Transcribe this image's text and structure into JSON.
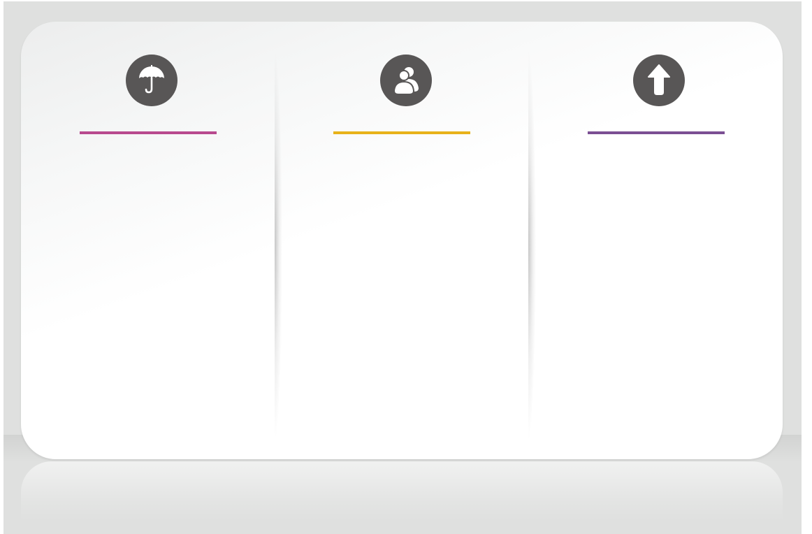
{
  "colors": {
    "card_background": "#ffffff",
    "backdrop": "#dfe0df",
    "icon_circle": "#585656",
    "icon_glyph": "#ffffff"
  },
  "panels": [
    {
      "icon": "umbrella-icon",
      "accent_color": "#b84a8e"
    },
    {
      "icon": "users-icon",
      "accent_color": "#e8b21a"
    },
    {
      "icon": "arrow-up-icon",
      "accent_color": "#7b4f93"
    }
  ]
}
